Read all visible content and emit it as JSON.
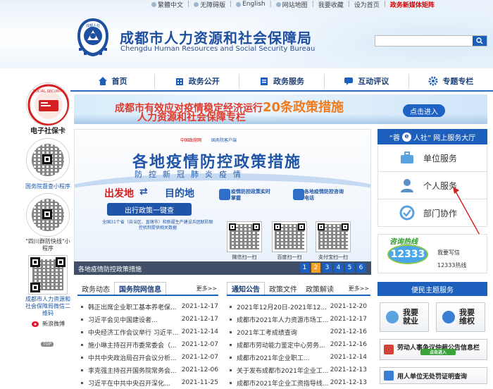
{
  "topbar": {
    "items": [
      "繁體中文",
      "无障碍版",
      "English",
      "网站地图",
      "我要收藏",
      "设为首页"
    ],
    "highlight": "政务新媒体矩阵"
  },
  "header": {
    "title_cn": "成都市人力资源和社会保障局",
    "title_en": "Chengdu Human Resources and Social Security Bureau",
    "logo_text": "成都人社"
  },
  "search": {
    "placeholder": ""
  },
  "nav": [
    "首页",
    "政务公开",
    "政务服务",
    "互动评议",
    "专题专栏"
  ],
  "left": {
    "ecard_label": "电子社保卡",
    "qr1_label": "国务院督查小程序",
    "qr2_label": "\"四川群防快线\"小程序",
    "qr3_label": "成都市人力资源和社会保障局微信二维码",
    "weibo_label": "新浪微博",
    "top_label": "TOP"
  },
  "banner": {
    "line1_pre": "成都市有效应对疫情稳定经济运行",
    "line1_num": "20条政策措施",
    "line2": "人力资源和社会保障专栏",
    "button": "点击进入"
  },
  "slider": {
    "logo1": "中国政府网",
    "logo2": "国务院客户端",
    "headline": "各地疫情防控政策措施",
    "subline": "防控新冠肺炎疫情",
    "from": "出发地",
    "to": "目的地",
    "oneclick": "出行政策一键查",
    "note": "全国31个省（自治区、直辖市）和新疆生产建设兵团联防联控机制提供相关数据",
    "svc1": "疫情防控政策实时掌握",
    "svc2": "各地疫情防控咨询电话",
    "qr_labels": [
      "微信扫一扫",
      "百度扫一扫",
      "支付宝扫一扫"
    ],
    "caption": "各地疫情防控政策措施",
    "pages": [
      "1",
      "2",
      "3",
      "4",
      "5",
      "6"
    ],
    "active_page": "2"
  },
  "right": {
    "head_pre": "“蓉",
    "head_e": "e",
    "head_post": "人社” 网上服务大厅",
    "services": [
      "单位服务",
      "个人服务",
      "部门协作"
    ],
    "hotline_title": "咨询热线",
    "hotline_number": "12333",
    "hotline_sub": "人力资源和社会保障",
    "hotline_a": "我要写信",
    "hotline_b": "12333热线",
    "theme_head": "便民主题服务",
    "btn_jobs": [
      "我要",
      "就业"
    ],
    "btn_rights": [
      "我要",
      "维权"
    ],
    "bar1": "劳动人事争议仲裁公告信息栏",
    "bar1_btn": "点击进入",
    "bar2": "用人单位无处罚证明查询"
  },
  "news1": {
    "tabs": [
      "政务动态",
      "国务院网信息"
    ],
    "active": "国务院网信息",
    "more": "更多>>",
    "items": [
      {
        "t": "韩正出席企业职工基本养老保...",
        "d": "2021-12-17"
      },
      {
        "t": "习近平会见中国建设者...",
        "d": "2021-12-17"
      },
      {
        "t": "中央经济工作会议举行 习近平...",
        "d": "2021-12-14"
      },
      {
        "t": "施小琳主持召开市委常委会（...",
        "d": "2021-12-07"
      },
      {
        "t": "中共中央政治局召开会议分析...",
        "d": "2021-12-07"
      },
      {
        "t": "李克强主持召开国务院常务会...",
        "d": "2021-12-06"
      },
      {
        "t": "习近平在中共中央召开深化...",
        "d": "2021-11-25"
      }
    ]
  },
  "news2": {
    "tabs": [
      "通知公告",
      "政策文件",
      "政策解读"
    ],
    "active": "通知公告",
    "more": "更多>>",
    "items": [
      {
        "t": "2021年12月20日-2021年12...",
        "d": "2021-12-20"
      },
      {
        "t": "成都市2021年人力资源市场工...",
        "d": "2021-12-17"
      },
      {
        "t": "2021年工考成绩查询",
        "d": "2021-12-16"
      },
      {
        "t": "成都市劳动能力鉴定中心劳务...",
        "d": "2021-12-16"
      },
      {
        "t": "成都市2021年企业职工...",
        "d": "2021-12-14"
      },
      {
        "t": "关于发布成都市2021年企业工...",
        "d": "2021-12-13"
      },
      {
        "t": "成都市2021年企业工资指导线...",
        "d": "2021-12-13"
      }
    ]
  },
  "colors": {
    "primary": "#1c5fbd",
    "accent_red": "#d60000",
    "banner_orange": "#f07b1a"
  }
}
